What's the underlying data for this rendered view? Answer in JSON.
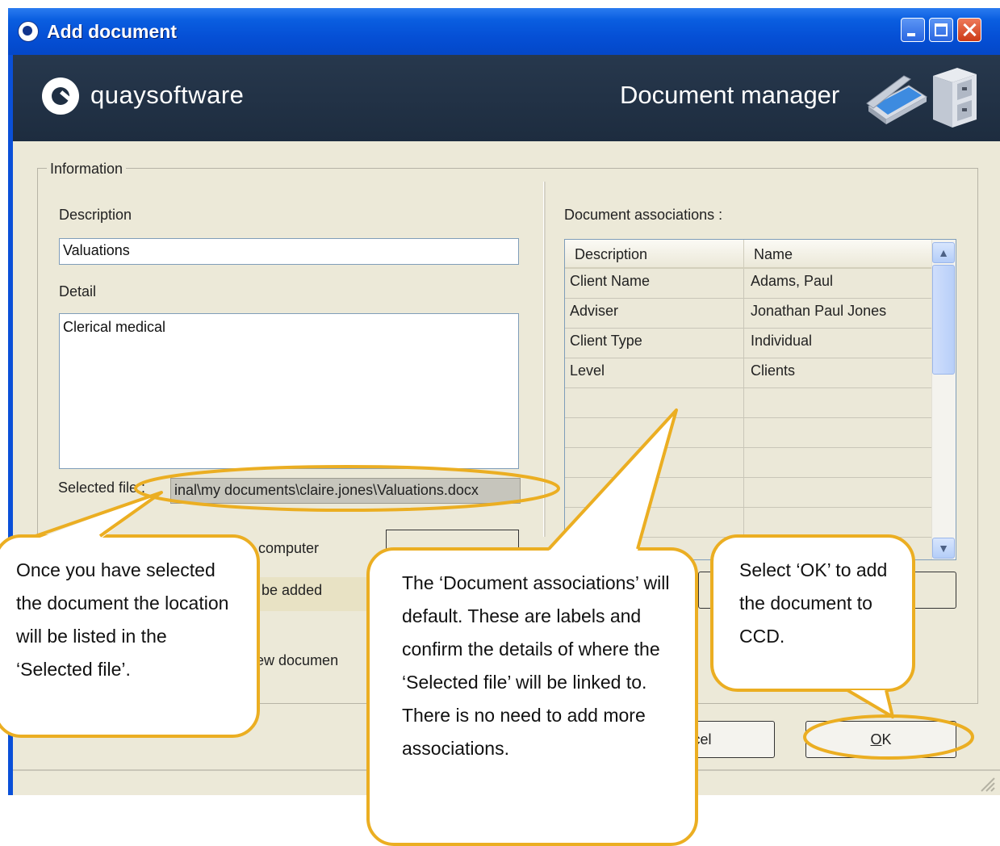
{
  "window": {
    "title": "Add document"
  },
  "banner": {
    "brand": "quaysoftware",
    "title": "Document manager"
  },
  "information": {
    "legend": "Information",
    "description_label": "Description",
    "description_value": "Valuations",
    "detail_label": "Detail",
    "detail_value": "Clerical medical",
    "selected_file_label": "Selected file :",
    "selected_file_value": "inal\\my documents\\claire.jones\\Valuations.docx",
    "computer_text": "m your computer",
    "added_text": "s to be added",
    "newdoc_text": "a new documen"
  },
  "associations": {
    "label": "Document associations :",
    "columns": [
      "Description",
      "Name"
    ],
    "rows": [
      [
        "Client Name",
        "Adams, Paul"
      ],
      [
        "Adviser",
        "Jonathan Paul Jones"
      ],
      [
        "Client Type",
        "Individual"
      ],
      [
        "Level",
        "Clients"
      ]
    ]
  },
  "buttons": {
    "cancel": "ancel",
    "ok_underlined": "O",
    "ok_rest": "K"
  },
  "callouts": {
    "left": "Once you have selected the document the location will be listed in the ‘Selected file’.",
    "middle": "The ‘Document associations’ will default. These are labels and confirm the details of where the ‘Selected file’ will be linked to.  There is no need to add more associations.",
    "right": "Select ‘OK’ to add the document to CCD."
  },
  "colors": {
    "titlebar": "#0550d6",
    "banner": "#1f2f43",
    "dialog": "#ece9d8",
    "annotation": "#ebae22"
  },
  "icons": [
    "app-icon",
    "minimize-icon",
    "maximize-icon",
    "close-icon",
    "quay-logo-icon",
    "scanner-icon",
    "filing-cabinet-icon",
    "scroll-up-icon",
    "scroll-down-icon",
    "resize-grip-icon"
  ]
}
